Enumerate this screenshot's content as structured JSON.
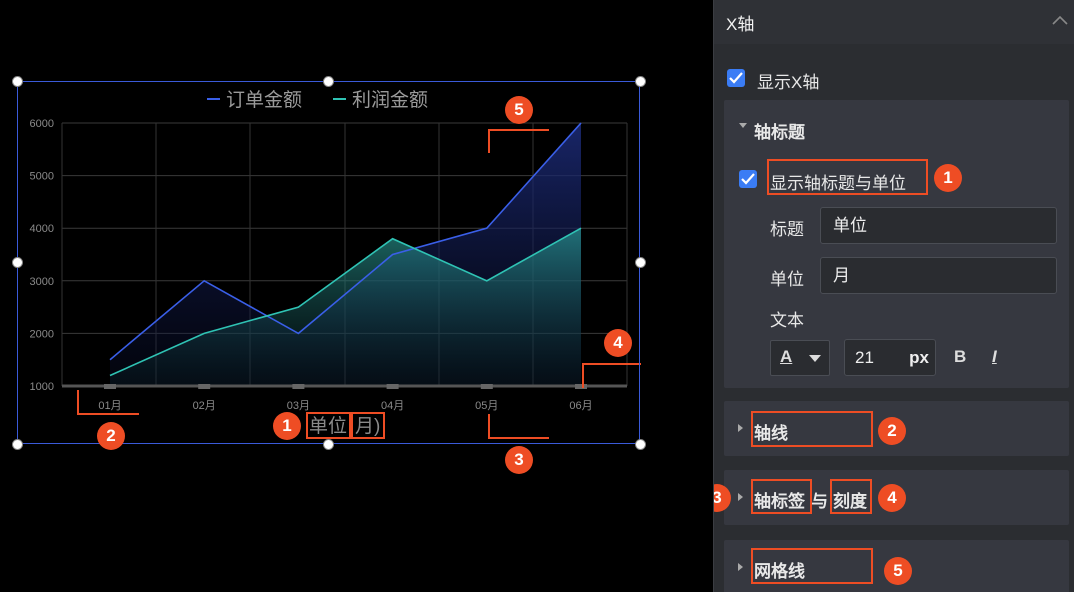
{
  "chart_data": {
    "type": "area",
    "categories": [
      "01月",
      "02月",
      "03月",
      "04月",
      "05月",
      "06月"
    ],
    "series": [
      {
        "name": "订单金额",
        "values": [
          1500,
          3000,
          2000,
          3500,
          4000,
          6000
        ],
        "color": "#3a5fe8"
      },
      {
        "name": "利润金额",
        "values": [
          1200,
          2000,
          2500,
          3800,
          3000,
          4000
        ],
        "color": "#2fc3b4"
      }
    ],
    "yticks": [
      "1000",
      "2000",
      "3000",
      "4000",
      "5000",
      "6000"
    ],
    "ylim": [
      1000,
      6000
    ],
    "grid": true,
    "legend": "top",
    "xlabel": "(单位(月))"
  },
  "canvas": {
    "axis_title_unit": "单位",
    "axis_title_paren": "月)"
  },
  "annotations": {
    "n1": "1",
    "n2": "2",
    "n3": "3",
    "n4": "4",
    "n5": "5",
    "color": "#ee4d24"
  },
  "panel": {
    "title": "X轴",
    "show_x_axis": "显示X轴",
    "axis_title_section": "轴标题",
    "show_axis_title_unit": "显示轴标题与单位",
    "title_label": "标题",
    "title_value": "单位",
    "unit_label": "单位",
    "unit_value": "月",
    "text_label": "文本",
    "font_color_glyph": "A",
    "font_size": "21",
    "font_size_unit": "px",
    "bold": "B",
    "italic": "I",
    "axis_line": "轴线",
    "axis_label_tick_a": "轴标签",
    "axis_label_tick_b": "与",
    "axis_label_tick_c": "刻度",
    "grid_lines": "网格线"
  }
}
